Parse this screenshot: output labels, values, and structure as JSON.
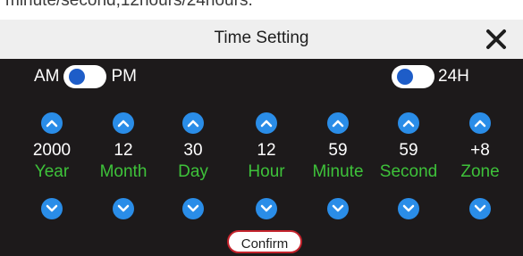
{
  "caption": "minute/second,12hours/24hours.",
  "header": {
    "title": "Time Setting"
  },
  "toggles": {
    "am_label": "AM",
    "pm_label": "PM",
    "format_label": "24H"
  },
  "columns": [
    {
      "value": "2000",
      "label": "Year"
    },
    {
      "value": "12",
      "label": "Month"
    },
    {
      "value": "30",
      "label": "Day"
    },
    {
      "value": "12",
      "label": "Hour"
    },
    {
      "value": "59",
      "label": "Minute"
    },
    {
      "value": "59",
      "label": "Second"
    },
    {
      "value": "+8",
      "label": "Zone"
    }
  ],
  "confirm_label": "Confirm",
  "colors": {
    "accent_blue": "#2a8de8",
    "label_green": "#3ec23a",
    "confirm_border": "#c4232c",
    "panel_bg": "#1d1a1b"
  },
  "icons": {
    "close": "close-icon",
    "up": "chevron-up-icon",
    "down": "chevron-down-icon"
  }
}
